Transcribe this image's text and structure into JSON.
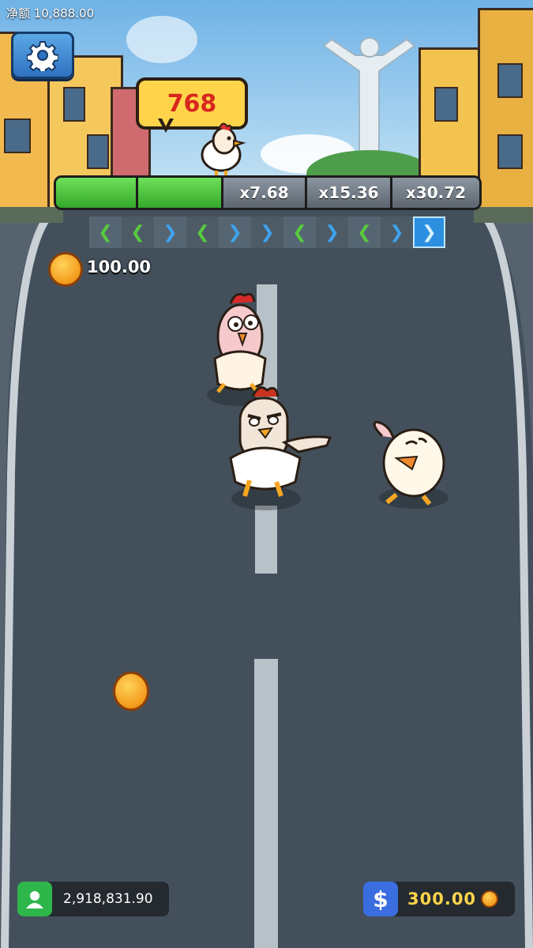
{
  "hud": {
    "net_label": "净额 10,888.00",
    "score": "768",
    "bet_amount": "100.00",
    "balance": "2,918,831.90",
    "stake": "300.00"
  },
  "progress": {
    "filled_segments": 2,
    "multipliers": [
      "x7.68",
      "x15.36",
      "x30.72"
    ]
  },
  "lanes": {
    "arrows": [
      "left",
      "left",
      "right",
      "left",
      "right",
      "right",
      "left",
      "right",
      "left",
      "right",
      "right"
    ],
    "active_index": 10
  },
  "colors": {
    "sky": "#6fb2e6",
    "road": "#3f4c59",
    "progress_fill": "#34a82a",
    "score_text": "#d8261e",
    "stake_text": "#ffd44a"
  }
}
